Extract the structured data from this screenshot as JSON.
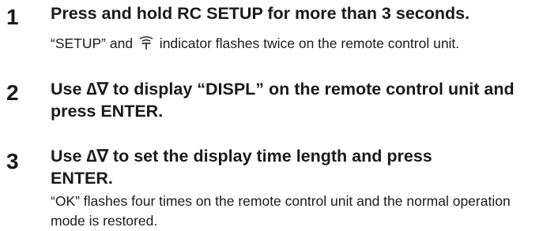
{
  "steps": [
    {
      "number": "1",
      "title": "Press and hold RC SETUP for more than 3 seconds.",
      "note_before_icon": "“SETUP” and ",
      "note_icon": "signal-icon",
      "note_after_icon": " indicator flashes twice on the remote control unit."
    },
    {
      "number": "2",
      "title": "Use ∆∇ to display “DISPL” on the remote control unit and press ENTER."
    },
    {
      "number": "3",
      "title": "Use ∆∇ to set the display time length and press ENTER.",
      "note": "“OK” flashes four times on the remote control unit and the normal operation mode is restored."
    }
  ]
}
